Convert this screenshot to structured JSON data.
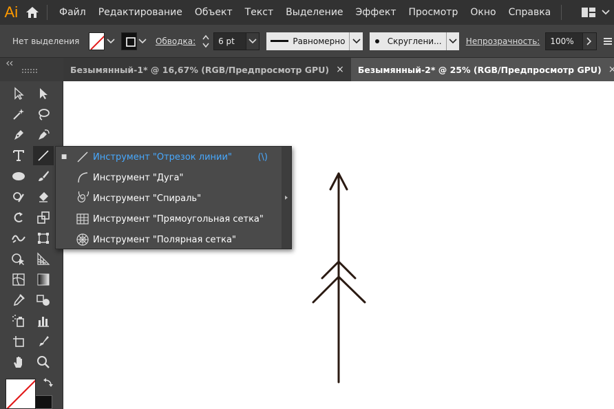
{
  "app": {
    "logo": "Ai"
  },
  "menu": {
    "items": [
      "Файл",
      "Редактирование",
      "Объект",
      "Текст",
      "Выделение",
      "Эффект",
      "Просмотр",
      "Окно",
      "Справка"
    ]
  },
  "control": {
    "selection_label": "Нет выделения",
    "stroke_link": "Обводка:",
    "stroke_weight": "6 pt",
    "profile_label": "Равномерно",
    "brush_label": "Скруглени...",
    "opacity_link": "Непрозрачность:",
    "opacity_value": "100%"
  },
  "tabs": [
    {
      "label": "Безымянный-1* @ 16,67% (RGB/Предпросмотр GPU)",
      "close": "×"
    },
    {
      "label": "Безымянный-2* @ 25% (RGB/Предпросмотр GPU)",
      "close": "×"
    }
  ],
  "flyout": {
    "items": [
      {
        "label": "Инструмент \"Отрезок линии\"",
        "shortcut": "(\\)",
        "bullet": "■"
      },
      {
        "label": "Инструмент \"Дуга\""
      },
      {
        "label": "Инструмент \"Спираль\""
      },
      {
        "label": "Инструмент \"Прямоугольная сетка\""
      },
      {
        "label": "Инструмент \"Полярная сетка\""
      }
    ]
  },
  "colors": {
    "accent": "#47a9ff",
    "ai_orange": "#ff9a00",
    "canvas": "#ffffff",
    "artwork_stroke": "#2a1a12"
  },
  "icons": {
    "tools": [
      "selection-icon",
      "direct-selection-icon",
      "magic-wand-icon",
      "lasso-icon",
      "pen-icon",
      "curvature-icon",
      "type-icon",
      "line-segment-icon",
      "ellipse-icon",
      "paintbrush-icon",
      "shaper-icon",
      "eraser-icon",
      "rotate-icon",
      "scale-icon",
      "warp-icon",
      "free-transform-icon",
      "shape-builder-icon",
      "perspective-grid-icon",
      "mesh-icon",
      "gradient-icon",
      "eyedropper-icon",
      "blend-icon",
      "symbol-sprayer-icon",
      "column-graph-icon",
      "artboard-icon",
      "slice-icon",
      "hand-icon",
      "zoom-icon"
    ]
  }
}
